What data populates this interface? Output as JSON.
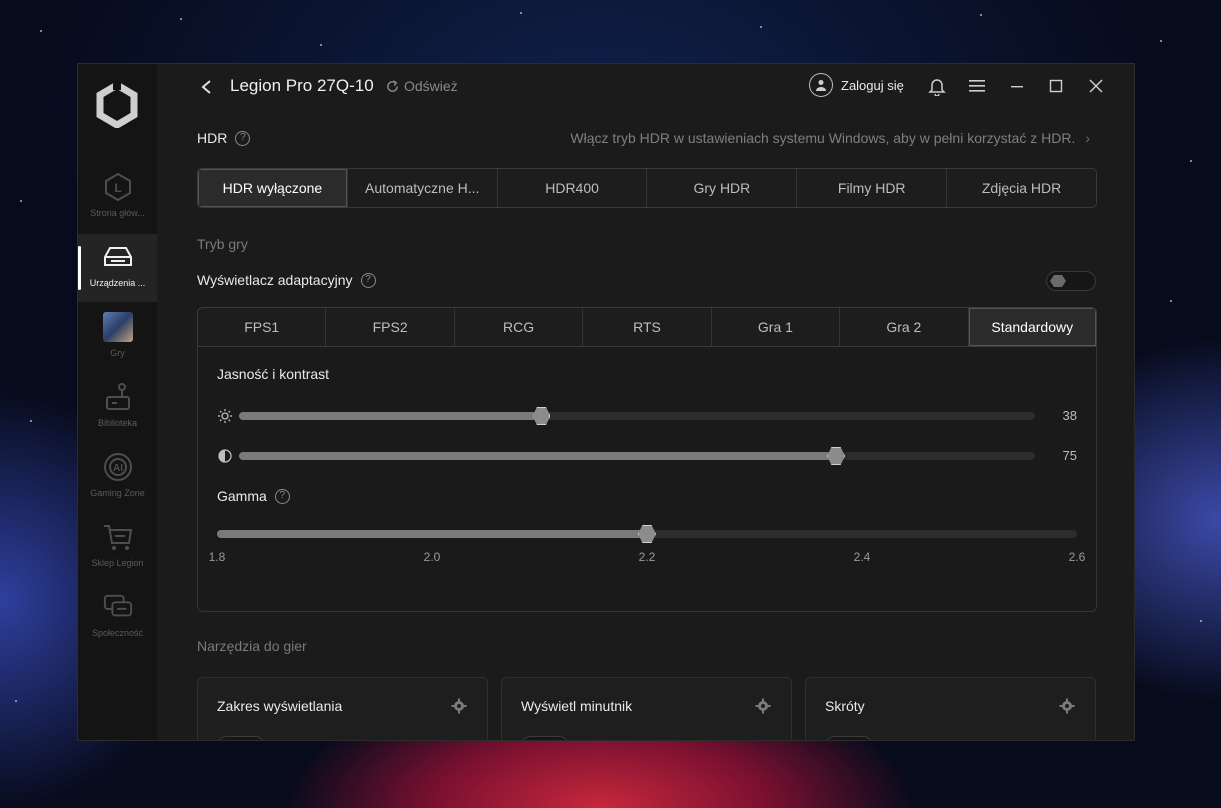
{
  "sidebar": {
    "items": [
      {
        "label": "Strona głów...",
        "icon": "home-l-icon"
      },
      {
        "label": "Urządzenia ...",
        "icon": "device-icon",
        "active": true
      },
      {
        "label": "Gry",
        "icon": "games-thumbnail"
      },
      {
        "label": "Biblioteka",
        "icon": "joystick-icon"
      },
      {
        "label": "Gaming Zone",
        "icon": "ai-icon"
      },
      {
        "label": "Sklep Legion",
        "icon": "cart-icon"
      },
      {
        "label": "Społeczność",
        "icon": "chat-icon"
      }
    ]
  },
  "titlebar": {
    "device_name": "Legion Pro 27Q-10",
    "refresh_label": "Odśwież",
    "login_label": "Zaloguj się"
  },
  "hdr": {
    "label": "HDR",
    "note": "Włącz tryb HDR w ustawieniach systemu Windows, aby w pełni korzystać z HDR.",
    "options": [
      "HDR wyłączone",
      "Automatyczne H...",
      "HDR400",
      "Gry HDR",
      "Filmy HDR",
      "Zdjęcia HDR"
    ],
    "selected_index": 0
  },
  "game_mode": {
    "section_label": "Tryb gry",
    "adaptive_label": "Wyświetlacz adaptacyjny",
    "adaptive_enabled": false,
    "modes": [
      "FPS1",
      "FPS2",
      "RCG",
      "RTS",
      "Gra 1",
      "Gra 2",
      "Standardowy"
    ],
    "selected_index": 6,
    "brightness_contrast_title": "Jasność i kontrast",
    "brightness": 38,
    "contrast": 75,
    "gamma_title": "Gamma",
    "gamma_ticks": [
      "1.8",
      "2.0",
      "2.2",
      "2.4",
      "2.6"
    ],
    "gamma_value": 2.2
  },
  "tools": {
    "section_label": "Narzędzia do gier",
    "cards": [
      "Zakres wyświetlania",
      "Wyświetl minutnik",
      "Skróty"
    ]
  },
  "colors": {
    "window_bg": "#1b1b1b",
    "sidebar_bg": "#141414",
    "accent_text": "#eaeaea",
    "muted_text": "#7f7f7f"
  }
}
